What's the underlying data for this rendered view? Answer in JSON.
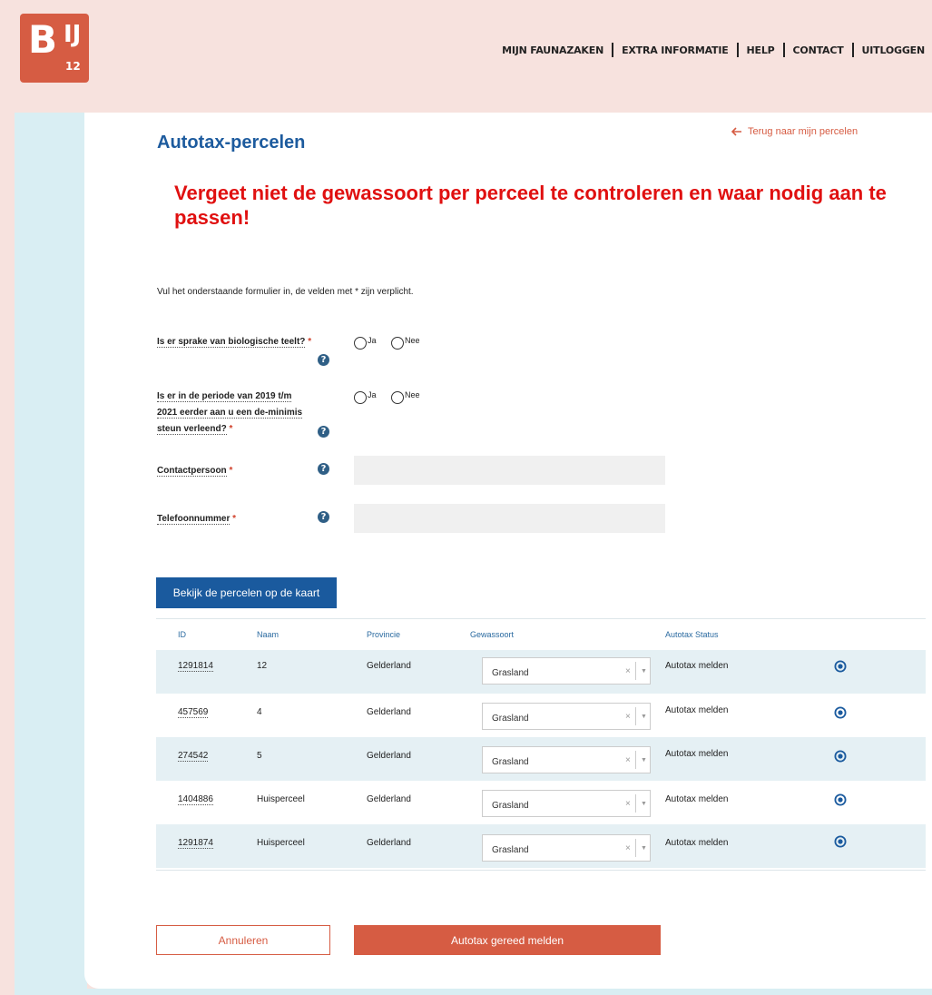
{
  "logo": {
    "main": "B",
    "sup": "IJ",
    "sub": "12"
  },
  "nav": [
    "MIJN FAUNAZAKEN",
    "EXTRA INFORMATIE",
    "HELP",
    "CONTACT",
    "UITLOGGEN"
  ],
  "page": {
    "title": "Autotax-percelen",
    "back_link": "Terug naar mijn percelen",
    "warning": "Vergeet niet de gewassoort per perceel te controleren en waar nodig aan te passen!",
    "intro": "Vul het onderstaande formulier in, de velden met * zijn verplicht."
  },
  "form": {
    "q1": {
      "label": "Is er sprake van biologische teelt?",
      "req": "*",
      "yes": "Ja",
      "no": "Nee"
    },
    "q2": {
      "line1": "Is er in de periode van 2019 t/m",
      "line2": "2021 eerder aan u een de-minimis",
      "line3": "steun verleend?",
      "req": "*",
      "yes": "Ja",
      "no": "Nee"
    },
    "contact": {
      "label": "Contactpersoon",
      "req": "*",
      "value": ""
    },
    "phone": {
      "label": "Telefoonnummer",
      "req": "*",
      "value": ""
    },
    "help_glyph": "?"
  },
  "map_button": "Bekijk de percelen op de kaart",
  "table": {
    "headers": {
      "id": "ID",
      "name": "Naam",
      "province": "Provincie",
      "crop": "Gewassoort",
      "status": "Autotax Status"
    },
    "rows": [
      {
        "id": "1291814",
        "name": "12",
        "province": "Gelderland",
        "crop": "Grasland",
        "status": "Autotax melden"
      },
      {
        "id": "457569",
        "name": "4",
        "province": "Gelderland",
        "crop": "Grasland",
        "status": "Autotax melden"
      },
      {
        "id": "274542",
        "name": "5",
        "province": "Gelderland",
        "crop": "Grasland",
        "status": "Autotax melden"
      },
      {
        "id": "1404886",
        "name": "Huisperceel",
        "province": "Gelderland",
        "crop": "Grasland",
        "status": "Autotax melden"
      },
      {
        "id": "1291874",
        "name": "Huisperceel",
        "province": "Gelderland",
        "crop": "Grasland",
        "status": "Autotax melden"
      }
    ],
    "clear_glyph": "×",
    "arrow_glyph": "▼"
  },
  "buttons": {
    "cancel": "Annuleren",
    "submit": "Autotax gereed melden"
  },
  "colors": {
    "brand": "#d65c43",
    "primary": "#1a5a9e",
    "warning": "#e01010",
    "panel_bg": "#d9eef3"
  }
}
